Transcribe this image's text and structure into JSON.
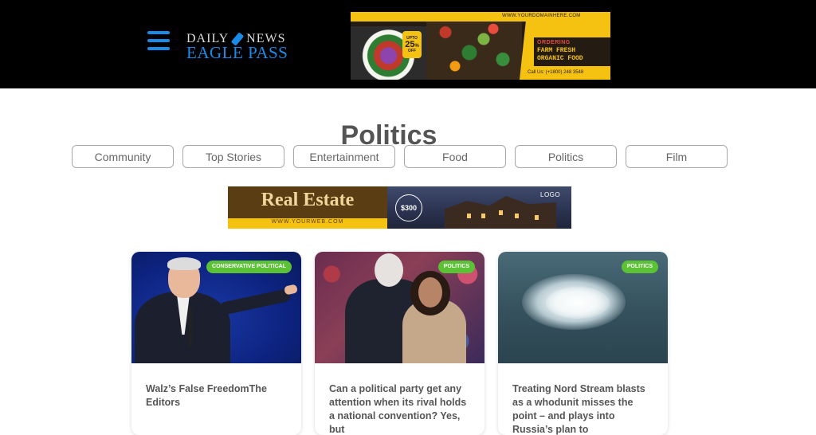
{
  "header": {
    "menu_icon": "hamburger-menu-icon",
    "logo": {
      "line1_left": "DAILY",
      "line1_right": "NEWS",
      "line2": "EAGLE PASS"
    }
  },
  "ads": {
    "top_banner": {
      "url": "WWW.YOURDOMAINHERE.COM",
      "badge_top": "UPTO",
      "badge_value": "25",
      "badge_bottom": "OFF",
      "ordering": "ORDERING",
      "line1": "FARM FRESH",
      "line2": "ORGANIC FOOD",
      "call": "Call Us: (+1800) 248 3548"
    },
    "mid_banner": {
      "title": "Real Estate",
      "url": "WWW.YOURWEB.COM",
      "price": "$300",
      "logo": "LOGO"
    }
  },
  "page": {
    "title": "Politics"
  },
  "categories": [
    "Community",
    "Top Stories",
    "Entertainment",
    "Food",
    "Politics",
    "Film"
  ],
  "articles": [
    {
      "tag": "CONSERVATIVE POLITICAL",
      "headline": "Walz’s False FreedomThe Editors"
    },
    {
      "tag": "POLITICS",
      "headline": "Can a political party get any attention when its rival holds a national convention? Yes, but"
    },
    {
      "tag": "POLITICS",
      "headline": "Treating Nord Stream blasts as a whodunit misses the point – and plays into Russia’s plan to"
    }
  ],
  "colors": {
    "accent": "#1a8be8",
    "tag_green": "#5bc236",
    "header_bg": "#000000",
    "ad_yellow": "#f5c211"
  }
}
